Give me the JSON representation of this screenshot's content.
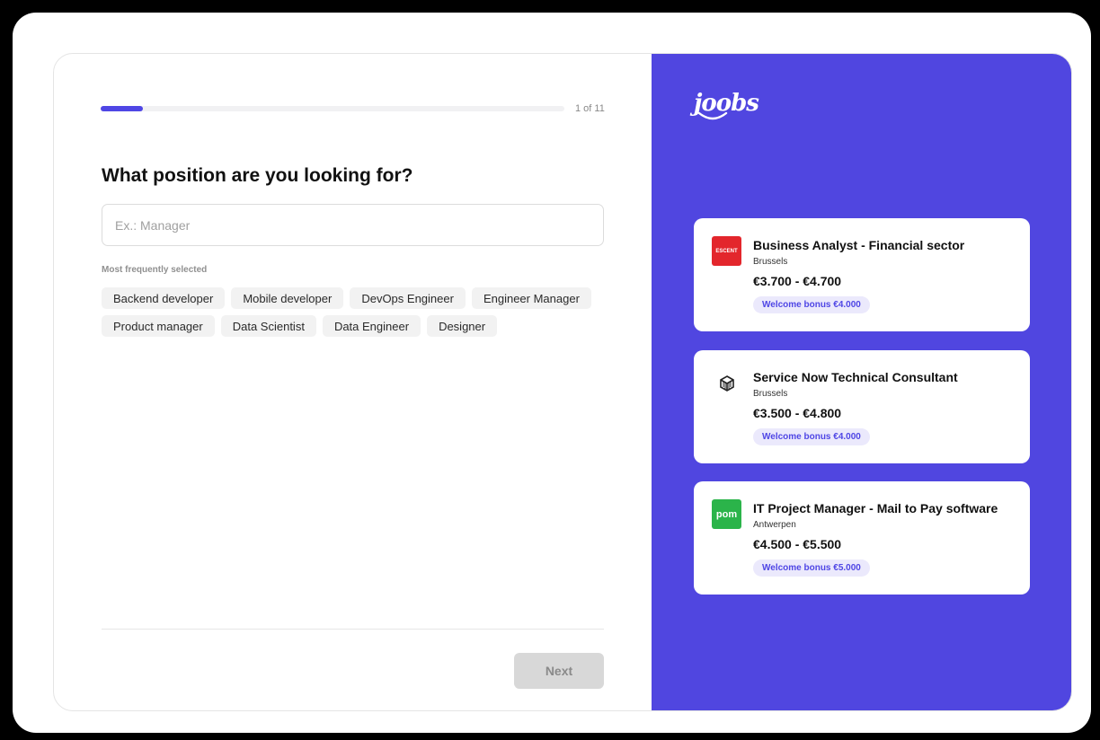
{
  "progress": {
    "step_label": "1 of 11",
    "fraction": 0.0909,
    "color": "#4f46e5"
  },
  "question": "What position are you looking for?",
  "search": {
    "placeholder": "Ex.: Manager",
    "value": ""
  },
  "frequent_label": "Most frequently selected",
  "chips": [
    "Backend developer",
    "Mobile developer",
    "DevOps Engineer",
    "Engineer Manager",
    "Product manager",
    "Data Scientist",
    "Data Engineer",
    "Designer"
  ],
  "next_label": "Next",
  "brand": {
    "logo_text": "joobs",
    "panel_color": "#5046e0"
  },
  "jobs": [
    {
      "title": "Business Analyst - Financial sector",
      "city": "Brussels",
      "salary": "€3.700 - €4.700",
      "bonus": "Welcome bonus €4.000",
      "company_logo_text": "ESCENT",
      "logo_color": "#e3262c"
    },
    {
      "title": "Service Now Technical Consultant",
      "city": "Brussels",
      "salary": "€3.500 - €4.800",
      "bonus": "Welcome bonus €4.000",
      "company_logo_text": "",
      "logo_color": "#ffffff"
    },
    {
      "title": "IT Project Manager - Mail to Pay software",
      "city": "Antwerpen",
      "salary": "€4.500 - €5.500",
      "bonus": "Welcome bonus €5.000",
      "company_logo_text": "pom",
      "logo_color": "#2bb44a"
    }
  ]
}
